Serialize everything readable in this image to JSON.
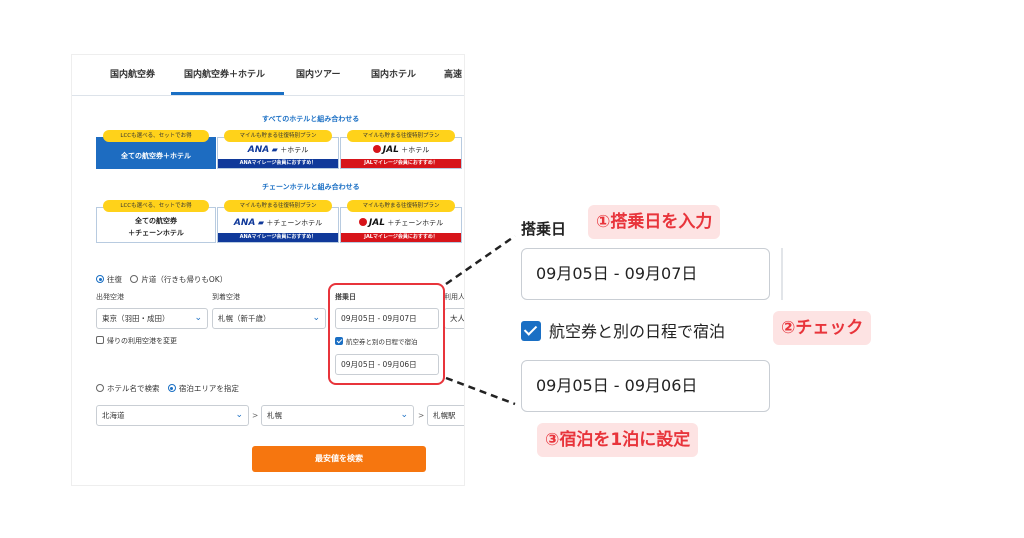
{
  "tabs": [
    "国内航空券",
    "国内航空券＋ホテル",
    "国内ツアー",
    "国内ホテル",
    "高速"
  ],
  "sections": {
    "all_hotels_title": "すべてのホテルと組み合わせる",
    "chain_hotels_title": "チェーンホテルと組み合わせる"
  },
  "cards_row1": [
    {
      "badge": "LCCも選べる、セットでお得",
      "main": "全ての航空券＋ホテル"
    },
    {
      "badge": "マイルも貯まる往復特別プラン",
      "logo": "ANA",
      "main": "＋ホテル",
      "strip": "ANAマイレージ会員におすすめ！"
    },
    {
      "badge": "マイルも貯まる往復特別プラン",
      "logo": "JAL",
      "main": "＋ホテル",
      "strip": "JALマイレージ会員におすすめ！"
    }
  ],
  "cards_row2": [
    {
      "badge": "LCCも選べる、セットでお得",
      "main1": "全ての航空券",
      "main2": "＋チェーンホテル"
    },
    {
      "badge": "マイルも貯まる往復特別プラン",
      "logo": "ANA",
      "main": "＋チェーンホテル",
      "strip": "ANAマイレージ会員におすすめ！"
    },
    {
      "badge": "マイルも貯まる往復特別プラン",
      "logo": "JAL",
      "main": "＋チェーンホテル",
      "strip": "JALマイレージ会員におすすめ！"
    }
  ],
  "trip": {
    "round": "往復",
    "oneway": "片道（行きも帰りもOK）"
  },
  "departure": {
    "label": "出発空港",
    "value": "東京（羽田・成田）"
  },
  "arrival": {
    "label": "到着空港",
    "value": "札幌（新千歳）"
  },
  "boarding": {
    "label": "搭乗日",
    "value": "09月05日 - 09月07日"
  },
  "passengers_label": "利用人",
  "passengers_value": "大人",
  "return_airport_change": "帰りの利用空港を変更",
  "separate_stay": "航空券と別の日程で宿泊",
  "stay_dates": "09月05日 - 09月06日",
  "hotel_mode": {
    "by_name": "ホテル名で検索",
    "by_area": "宿泊エリアを指定"
  },
  "area": {
    "pref": "北海道",
    "city": "札幌",
    "station": "札幌駅",
    "sep": ">"
  },
  "search_button": "最安値を検索",
  "zoom": {
    "label": "搭乗日",
    "boarding_value": "09月05日 - 09月07日",
    "checkbox_label": "航空券と別の日程で宿泊",
    "stay_value": "09月05日 - 09月06日"
  },
  "annotations": {
    "step1": "①搭乗日を入力",
    "step2": "②チェック",
    "step3": "③宿泊を1泊に設定"
  },
  "colors": {
    "accent": "#1a6fc4",
    "highlight": "#e8343b",
    "button": "#f6760f",
    "annotation_bg": "#fde3e3"
  }
}
